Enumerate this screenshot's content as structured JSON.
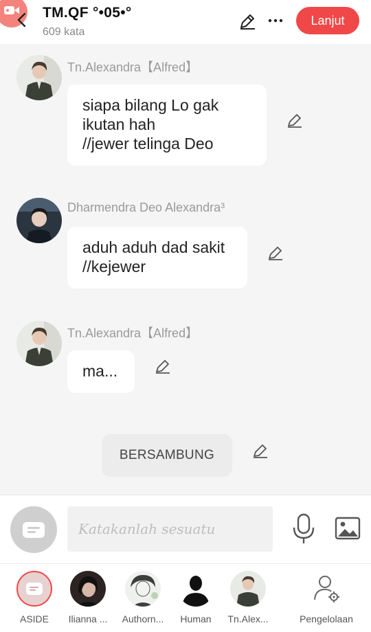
{
  "header": {
    "title": "TM.QF °•05•°",
    "word_count": "609 kata",
    "next_label": "Lanjut"
  },
  "messages": [
    {
      "sender": "Tn.Alexandra【Alfred】",
      "text": "siapa bilang Lo gak\nikutan hah\n//jewer telinga Deo"
    },
    {
      "sender": "Dharmendra Deo Alexandra³",
      "text": "aduh aduh dad sakit\n//kejewer"
    },
    {
      "sender": "Tn.Alexandra【Alfred】",
      "text": "ma..."
    }
  ],
  "continue_label": "BERSAMBUNG",
  "input": {
    "placeholder": "Katakanlah sesuatu"
  },
  "tabs": [
    {
      "label": "ASIDE"
    },
    {
      "label": "Ilianna ..."
    },
    {
      "label": "Authorn..."
    },
    {
      "label": "Human"
    },
    {
      "label": "Tn.Alex..."
    },
    {
      "label": "Pengelolaan"
    }
  ],
  "colors": {
    "accent": "#f04848",
    "background": "#f5f5f5",
    "bubble": "#ffffff"
  }
}
